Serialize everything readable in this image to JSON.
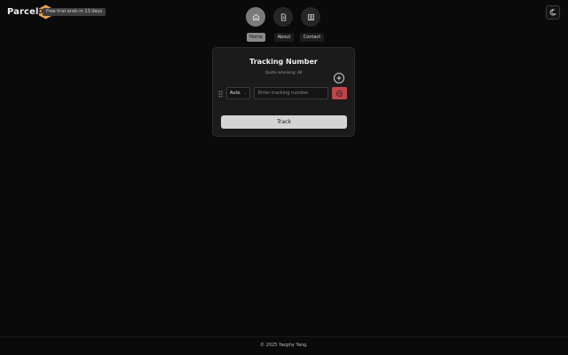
{
  "brand": {
    "name": "Parcel",
    "badge": "OTW",
    "badge_color": "#e8a24a"
  },
  "trial": {
    "text": "Free trial ends in 13 days"
  },
  "nav": {
    "items": [
      {
        "label": "Home",
        "icon": "home-icon",
        "active": true
      },
      {
        "label": "About",
        "icon": "document-icon",
        "active": false
      },
      {
        "label": "Contact",
        "icon": "contact-icon",
        "active": false
      }
    ]
  },
  "theme_toggle": {
    "icon": "moon-icon"
  },
  "tracker": {
    "title": "Tracking Number",
    "quota": "Quota remaining: 48",
    "carrier_value": "Auto",
    "input_placeholder": "Enter tracking number",
    "track_label": "Track",
    "remove_color": "#c0444a"
  },
  "footer": {
    "text": "© 2025 Yaophy Yang."
  }
}
